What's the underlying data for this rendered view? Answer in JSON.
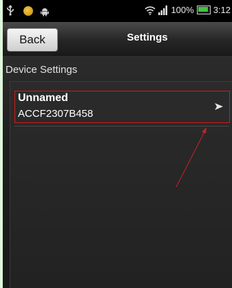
{
  "status_bar": {
    "battery_text": "100%",
    "time": "3:12",
    "icons": [
      "usb-icon",
      "weather-sun-icon",
      "android-icon",
      "wifi-icon",
      "signal-icon",
      "battery-icon"
    ]
  },
  "title_bar": {
    "back_label": "Back",
    "title": "Settings"
  },
  "section": {
    "header": "Device Settings"
  },
  "devices": [
    {
      "name": "Unnamed",
      "id": "ACCF2307B458"
    }
  ],
  "colors": {
    "highlight": "#d51a1a",
    "background": "#1e1e1e",
    "frame_outer": "#dff7dc"
  }
}
